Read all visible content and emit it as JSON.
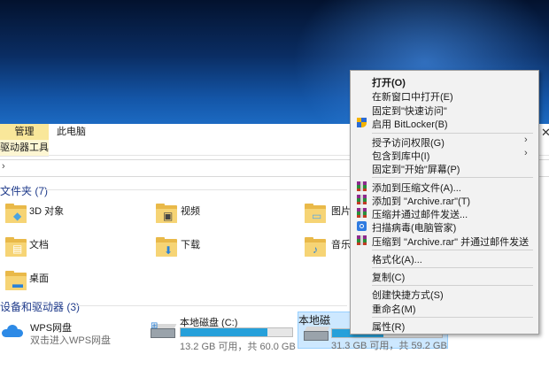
{
  "ribbon": {
    "manage_tab": "管理",
    "drive_tools_tab": "驱动器工具",
    "this_pc_tab": "此电脑",
    "close_glyph": "✕"
  },
  "address": {
    "chevron": "›"
  },
  "folders_section": {
    "header": "文件夹 (7)",
    "items": [
      "3D 对象",
      "视频",
      "图片",
      "文档",
      "下载",
      "音乐",
      "桌面"
    ]
  },
  "devices_section": {
    "header": "设备和驱动器 (3)",
    "wps": {
      "name": "WPS网盘",
      "subtitle": "双击进入WPS网盘"
    },
    "drive_c": {
      "name": "本地磁盘 (C:)",
      "free_text": "13.2 GB 可用，共 60.0 GB",
      "used_fraction": 0.78
    },
    "drive_d": {
      "name": "本地磁",
      "free_text": "31.3 GB 可用，共 59.2 GB",
      "used_fraction": 0.47
    }
  },
  "context_menu": {
    "items": [
      {
        "label": "打开(O)",
        "bold": true
      },
      {
        "label": "在新窗口中打开(E)"
      },
      {
        "label": "固定到\"快速访问\""
      },
      {
        "label": "启用 BitLocker(B)",
        "icon": "shield-icon"
      },
      {
        "label": "授予访问权限(G)",
        "submenu": true
      },
      {
        "label": "包含到库中(I)",
        "submenu": true
      },
      {
        "label": "固定到\"开始\"屏幕(P)"
      },
      {
        "label": "添加到压缩文件(A)...",
        "icon": "winrar-icon"
      },
      {
        "label": "添加到 \"Archive.rar\"(T)",
        "icon": "winrar-icon"
      },
      {
        "label": "压缩并通过邮件发送...",
        "icon": "winrar-icon"
      },
      {
        "label": "扫描病毒(电脑管家)",
        "icon": "scan-icon"
      },
      {
        "label": "压缩到 \"Archive.rar\" 并通过邮件发送",
        "icon": "winrar-icon"
      },
      {
        "label": "格式化(A)..."
      },
      {
        "label": "复制(C)"
      },
      {
        "label": "创建快捷方式(S)"
      },
      {
        "label": "重命名(M)"
      },
      {
        "label": "属性(R)"
      }
    ],
    "submenu_arrow": "›"
  },
  "colors": {
    "accent": "#26a0da",
    "section_header": "#1e3a8a",
    "manage_tab_bg": "#f9e79a"
  }
}
